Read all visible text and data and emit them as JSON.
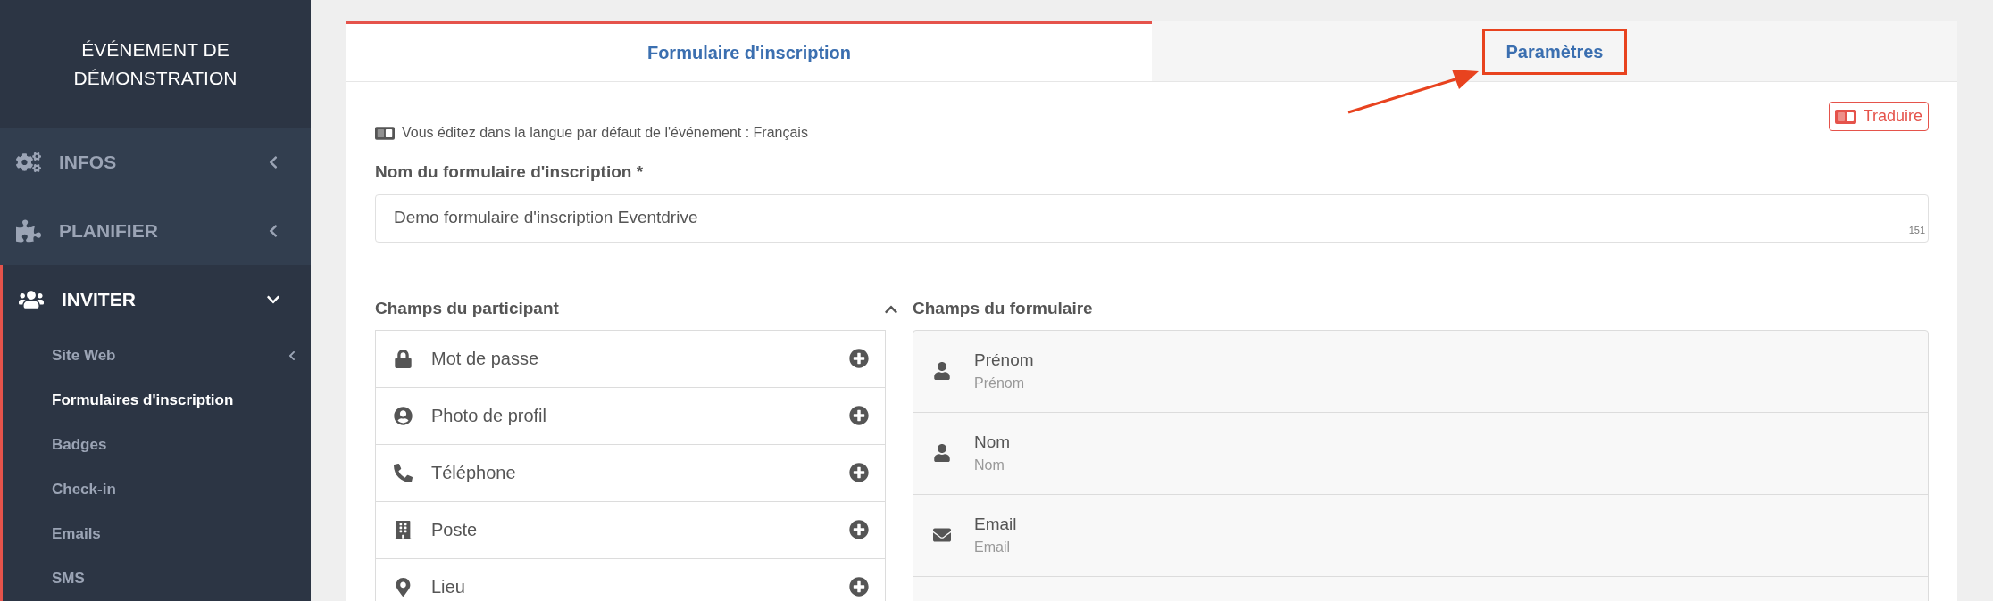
{
  "sidebar": {
    "event_title": "ÉVÉNEMENT DE DÉMONSTRATION",
    "sections": [
      {
        "label": "INFOS",
        "expanded": false
      },
      {
        "label": "PLANIFIER",
        "expanded": false
      },
      {
        "label": "INVITER",
        "expanded": true,
        "children": [
          {
            "label": "Site Web",
            "selected": false,
            "has_submenu": true
          },
          {
            "label": "Formulaires d'inscription",
            "selected": true,
            "has_submenu": false
          },
          {
            "label": "Badges",
            "selected": false,
            "has_submenu": false
          },
          {
            "label": "Check-in",
            "selected": false,
            "has_submenu": false
          },
          {
            "label": "Emails",
            "selected": false,
            "has_submenu": false
          },
          {
            "label": "SMS",
            "selected": false,
            "has_submenu": false
          }
        ]
      }
    ]
  },
  "tabs": [
    {
      "label": "Formulaire d'inscription",
      "selected": true,
      "highlighted": false
    },
    {
      "label": "Paramètres",
      "selected": false,
      "highlighted": true
    }
  ],
  "language_note": "Vous éditez dans la langue par défaut de l'événement : Français",
  "translate_button": "Traduire",
  "form_name": {
    "label": "Nom du formulaire d'inscription *",
    "value": "Demo formulaire d'inscription Eventdrive",
    "counter": "151"
  },
  "participant_fields": {
    "title": "Champs du participant",
    "expanded": true,
    "items": [
      {
        "label": "Mot de passe"
      },
      {
        "label": "Photo de profil"
      },
      {
        "label": "Téléphone"
      },
      {
        "label": "Poste"
      },
      {
        "label": "Lieu"
      }
    ]
  },
  "form_fields": {
    "title": "Champs du formulaire",
    "items": [
      {
        "label": "Prénom",
        "placeholder": "Prénom"
      },
      {
        "label": "Nom",
        "placeholder": "Nom"
      },
      {
        "label": "Email",
        "placeholder": "Email"
      }
    ]
  }
}
